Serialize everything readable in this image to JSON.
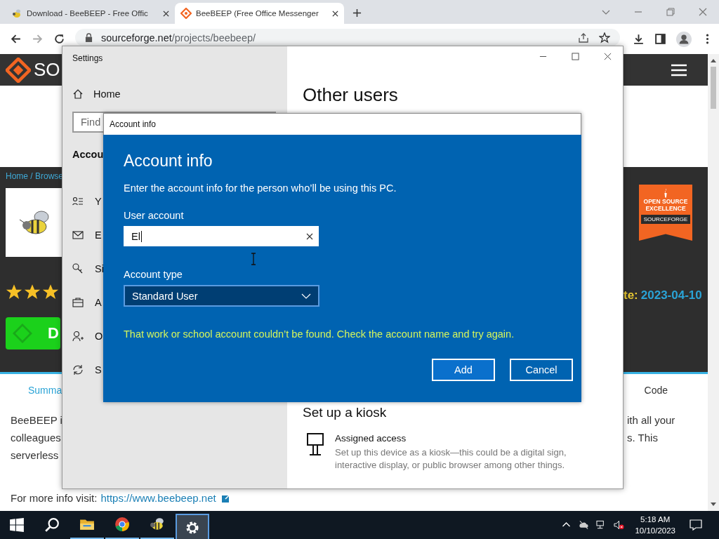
{
  "browser": {
    "tabs": [
      {
        "title": "Download - BeeBEEP - Free Offic",
        "selected": false
      },
      {
        "title": "BeeBEEP (Free Office Messenger",
        "selected": true
      }
    ],
    "address": {
      "domain": "sourceforge.net",
      "path": "/projects/beebeep/"
    }
  },
  "page": {
    "logo_text": "SO",
    "breadcrumb": "Home / Browse",
    "stars": 3,
    "download_label": "D",
    "updated_label": "te:",
    "updated_value": "2023-04-10",
    "badge": {
      "line1": "OPEN SOURCE",
      "line2": "EXCELLENCE",
      "brand": "SOURCEFORGE"
    },
    "tabs": [
      {
        "label": "Summa",
        "selected": true
      },
      {
        "label": "Code",
        "selected": false
      }
    ],
    "description_left": [
      "BeeBEEP i",
      "colleagues",
      "serverless"
    ],
    "description_right": [
      "ith all your",
      "s. This"
    ],
    "more_info": {
      "label": "For more info visit:",
      "link": "https://www.beebeep.net"
    }
  },
  "settings": {
    "title": "Settings",
    "home": "Home",
    "search_placeholder": "Find",
    "section": "Accou",
    "items": [
      {
        "kind": "info",
        "label": "Y"
      },
      {
        "kind": "email",
        "label": "E"
      },
      {
        "kind": "signin",
        "label": "Si"
      },
      {
        "kind": "work",
        "label": "A"
      },
      {
        "kind": "family",
        "label": "O"
      },
      {
        "kind": "sync",
        "label": "S"
      }
    ],
    "heading": "Other users",
    "kiosk_heading": "Set up a kiosk",
    "kiosk_item": {
      "title": "Assigned access",
      "description": "Set up this device as a kiosk—this could be a digital sign, interactive display, or public browser among other things."
    }
  },
  "dialog": {
    "title": "Account info",
    "heading": "Account info",
    "intro": "Enter the account info for the person who’ll be using this PC.",
    "user_account": {
      "label": "User account",
      "value": "El"
    },
    "account_type": {
      "label": "Account type",
      "value": "Standard User"
    },
    "error": "That work or school account couldn’t be found. Check the account name and try again.",
    "buttons": [
      {
        "kind": "primary",
        "label": "Add"
      },
      {
        "kind": "secondary",
        "label": "Cancel"
      }
    ]
  },
  "taskbar": {
    "buttons": [
      {
        "kind": "start",
        "running": false,
        "selected": false
      },
      {
        "kind": "search",
        "running": false,
        "selected": false
      },
      {
        "kind": "explorer",
        "running": true,
        "selected": false
      },
      {
        "kind": "chrome",
        "running": true,
        "selected": false
      },
      {
        "kind": "bee",
        "running": true,
        "selected": false
      },
      {
        "kind": "settings",
        "running": true,
        "selected": true
      }
    ],
    "time": "5:18 AM",
    "date": "10/10/2023"
  }
}
